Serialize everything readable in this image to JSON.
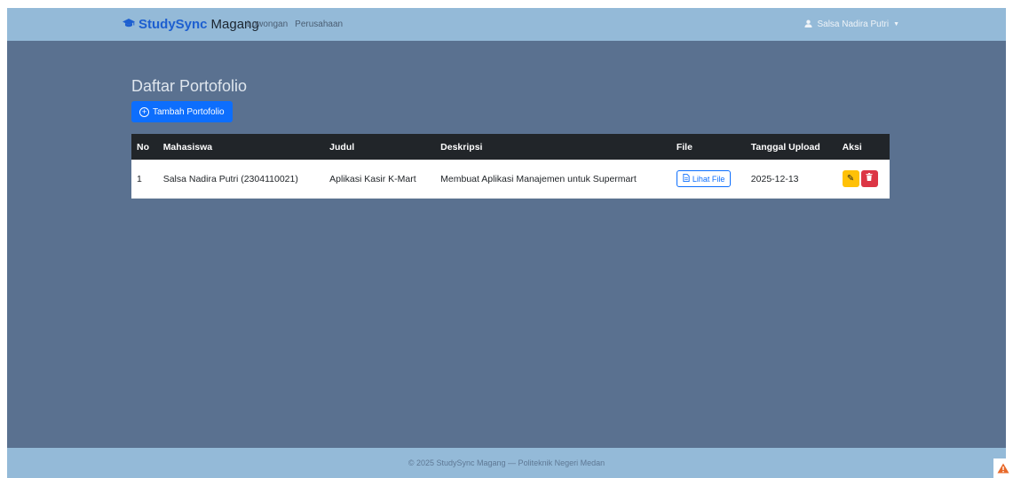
{
  "navbar": {
    "brand_icon": "graduation-cap-icon",
    "brand_primary": "StudySync",
    "brand_secondary": "Magang",
    "links": [
      "Lowongan",
      "Perusahaan"
    ],
    "user_name": "Salsa Nadira Putri",
    "user_icon": "user-icon"
  },
  "main": {
    "title": "Daftar Portofolio",
    "add_button": "Tambah Portofolio",
    "table": {
      "headers": [
        "No",
        "Mahasiswa",
        "Judul",
        "Deskripsi",
        "File",
        "Tanggal Upload",
        "Aksi"
      ],
      "rows": [
        {
          "no": "1",
          "mahasiswa": "Salsa Nadira Putri (2304110021)",
          "judul": "Aplikasi Kasir K-Mart",
          "deskripsi": "Membuat Aplikasi Manajemen untuk Supermart",
          "file_label": "Lihat File",
          "tanggal": "2025-12-13"
        }
      ]
    }
  },
  "footer": {
    "text": "© 2025 StudySync Magang — Politeknik Negeri Medan"
  },
  "colors": {
    "background": "#5a7190",
    "navbar": "#94bad8",
    "primary": "#0d6efd",
    "warning": "#ffc107",
    "danger": "#dc3545",
    "table_header": "#212529"
  }
}
